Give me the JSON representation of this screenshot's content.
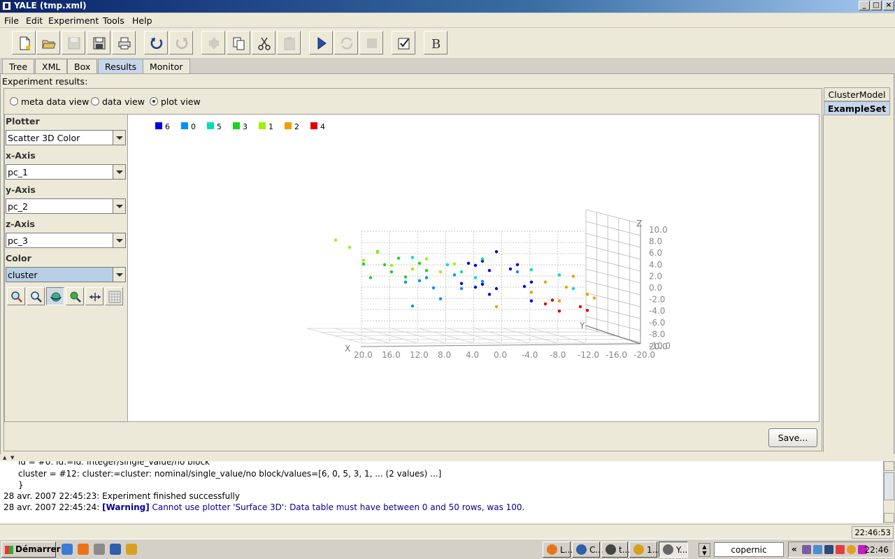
{
  "window": {
    "title": "YALE (tmp.xml)"
  },
  "menu": [
    "File",
    "Edit",
    "Experiment",
    "Tools",
    "Help"
  ],
  "tabs": [
    "Tree",
    "XML",
    "Box",
    "Results",
    "Monitor"
  ],
  "active_tab": "Results",
  "experiment_results_label": "Experiment results:",
  "side_tabs": [
    "ClusterModel",
    "ExampleSet"
  ],
  "active_side_tab": "ExampleSet",
  "view_options": {
    "meta": "meta data view",
    "data": "data view",
    "plot": "plot view",
    "selected": "plot view"
  },
  "controls": {
    "plotter_label": "Plotter",
    "plotter_value": "Scatter 3D Color",
    "x_label": "x-Axis",
    "x_value": "pc_1",
    "y_label": "y-Axis",
    "y_value": "pc_2",
    "z_label": "z-Axis",
    "z_value": "pc_3",
    "color_label": "Color",
    "color_value": "cluster"
  },
  "legend": [
    {
      "label": "6",
      "color": "#0000e0"
    },
    {
      "label": "0",
      "color": "#0090ff"
    },
    {
      "label": "5",
      "color": "#00e0b0"
    },
    {
      "label": "3",
      "color": "#20d020"
    },
    {
      "label": "1",
      "color": "#a0f000"
    },
    {
      "label": "2",
      "color": "#f0a000"
    },
    {
      "label": "4",
      "color": "#e00000"
    }
  ],
  "axes": {
    "x_name": "X",
    "y_name": "Y",
    "z_name": "Z",
    "x_ticks": [
      "20.0",
      "16.0",
      "12.0",
      "8.0",
      "4.0",
      "0.0",
      "-4.0",
      "-8.0",
      "-12.0",
      "-16.0",
      "-20.0"
    ],
    "z_ticks": [
      "10.0",
      "8.0",
      "6.0",
      "4.0",
      "2.0",
      "0.0",
      "-2.0",
      "-4.0",
      "-6.0",
      "-8.0",
      "-10.0"
    ],
    "y_tick_end": "20.0"
  },
  "save_label": "Save...",
  "log": {
    "lines": [
      {
        "text": "id = #0: id:=id: integer/single_value/no block",
        "indent": true
      },
      {
        "text": "cluster = #12: cluster:=cluster: nominal/single_value/no block/values=[6, 0, 5, 3, 1, ... (2 values) ...]",
        "indent": true
      },
      {
        "text": "}",
        "indent": true
      },
      {
        "text": "28 avr. 2007 22:45:23: Experiment finished successfully",
        "indent": false
      }
    ],
    "warning_prefix": "28 avr. 2007 22:45:24: ",
    "warning_tag": "[Warning]",
    "warning_text": " Cannot use plotter 'Surface 3D': Data table must have between 0 and 50 rows, was 100."
  },
  "status_time": "22:46:53",
  "taskbar": {
    "start": "Démarrer",
    "tasks": [
      "L...",
      "C...",
      "t...",
      "1...",
      "Y..."
    ],
    "search": "copernic",
    "clock": "22:46"
  },
  "chart_data": {
    "type": "scatter",
    "note_units": "projected 3D scatter, points given as (pc_1 approx, pc_3 approx) with cluster",
    "series": [
      {
        "name": "6",
        "points": [
          [
            1,
            6
          ],
          [
            -2,
            4
          ],
          [
            -1,
            3.5
          ],
          [
            3,
            4.5
          ],
          [
            4,
            4
          ],
          [
            5,
            4
          ],
          [
            2,
            3
          ],
          [
            6,
            1
          ],
          [
            4,
            0
          ],
          [
            2,
            -1
          ],
          [
            -3,
            0
          ],
          [
            -4,
            1
          ],
          [
            -4,
            -2
          ],
          [
            3,
            0.5
          ],
          [
            1,
            0
          ]
        ]
      },
      {
        "name": "0",
        "points": [
          [
            12,
            1
          ],
          [
            10,
            0
          ],
          [
            11,
            2
          ],
          [
            9,
            -2
          ],
          [
            6,
            0
          ],
          [
            7,
            2
          ],
          [
            14,
            1
          ],
          [
            -2,
            3
          ],
          [
            3,
            1
          ],
          [
            13,
            -3
          ]
        ]
      },
      {
        "name": "5",
        "points": [
          [
            13,
            5
          ],
          [
            8,
            4
          ],
          [
            4,
            2
          ],
          [
            -4,
            3
          ],
          [
            -10,
            0
          ],
          [
            -8,
            2
          ],
          [
            3,
            5
          ],
          [
            6,
            3
          ]
        ]
      },
      {
        "name": "3",
        "points": [
          [
            18,
            6
          ],
          [
            17,
            4
          ],
          [
            16,
            3
          ],
          [
            15,
            5
          ],
          [
            14,
            2
          ],
          [
            12,
            4
          ],
          [
            11,
            3
          ],
          [
            19,
            2
          ],
          [
            20,
            4
          ]
        ]
      },
      {
        "name": "1",
        "points": [
          [
            24,
            8
          ],
          [
            22,
            7
          ],
          [
            20,
            5
          ],
          [
            18,
            6
          ],
          [
            16,
            4
          ],
          [
            13,
            3
          ],
          [
            11,
            5
          ],
          [
            9,
            3
          ],
          [
            7,
            4
          ]
        ]
      },
      {
        "name": "2",
        "points": [
          [
            -4,
            -1
          ],
          [
            -6,
            1
          ],
          [
            -8,
            -2
          ],
          [
            -9,
            0
          ],
          [
            -12,
            -1
          ],
          [
            -13,
            -2
          ],
          [
            -10,
            2
          ],
          [
            1,
            -3
          ]
        ]
      },
      {
        "name": "4",
        "points": [
          [
            -6,
            -3
          ],
          [
            -8,
            -4
          ],
          [
            -11,
            -3
          ],
          [
            -12,
            -4
          ],
          [
            -7,
            -2
          ]
        ]
      }
    ]
  }
}
